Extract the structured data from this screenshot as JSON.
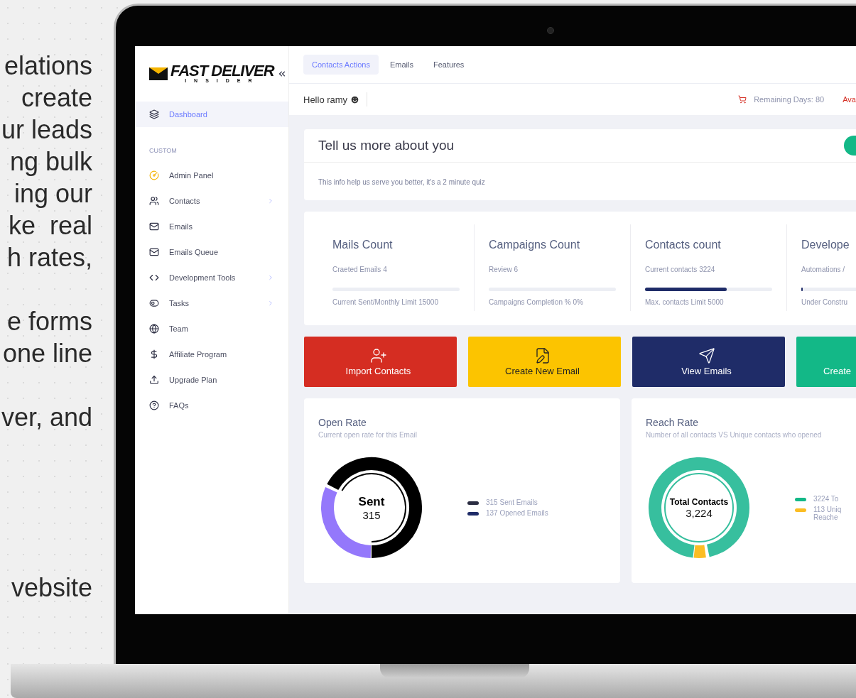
{
  "background_text": {
    "paragraphs": [
      [
        "elations",
        "create",
        "ur leads",
        "ng bulk",
        "ing our",
        "ke  real",
        "h rates,"
      ],
      [
        "e forms",
        "one line"
      ],
      [
        "ver, and"
      ],
      [
        "vebsite"
      ]
    ]
  },
  "logo": {
    "title": "FAST DELIVER",
    "subtitle": "INSIDER"
  },
  "sidebar": {
    "items": [
      {
        "label": "Dashboard",
        "selected": true,
        "expandable": false
      }
    ],
    "section": "CUSTOM",
    "section_items": [
      {
        "label": "Admin Panel",
        "selected": false,
        "expandable": false
      },
      {
        "label": "Contacts",
        "selected": false,
        "expandable": true
      },
      {
        "label": "Emails",
        "selected": false,
        "expandable": false
      },
      {
        "label": "Emails Queue",
        "selected": false,
        "expandable": false
      },
      {
        "label": "Development Tools",
        "selected": false,
        "expandable": true
      },
      {
        "label": "Tasks",
        "selected": false,
        "expandable": true
      },
      {
        "label": "Team",
        "selected": false,
        "expandable": false
      },
      {
        "label": "Affiliate Program",
        "selected": false,
        "expandable": false
      },
      {
        "label": "Upgrade Plan",
        "selected": false,
        "expandable": false
      },
      {
        "label": "FAQs",
        "selected": false,
        "expandable": false
      }
    ]
  },
  "tabs": [
    {
      "label": "Contacts Actions",
      "selected": true
    },
    {
      "label": "Emails",
      "selected": false
    },
    {
      "label": "Features",
      "selected": false
    }
  ],
  "header": {
    "greeting": "Hello ramy",
    "remaining": "Remaining Days: 80",
    "available": "Ava"
  },
  "intro_card": {
    "title": "Tell us more about you",
    "text": "This info help us serve you better, it's a 2 minute quiz"
  },
  "stats": [
    {
      "title": "Mails Count",
      "line": "Craeted Emails  4",
      "level": 0,
      "note": "Current Sent/Monthly Limit 15000"
    },
    {
      "title": "Campaigns Count",
      "line": "Review 6",
      "level": 0,
      "note": "Campaigns Completion % 0%"
    },
    {
      "title": "Contacts count",
      "line": "Current contacts 3224",
      "level": 0.64,
      "note": "Max. contacts Limit 5000"
    },
    {
      "title": "Develope",
      "line": "Automations /",
      "level": 0.01,
      "note": "Under Constru"
    }
  ],
  "actions": [
    {
      "label": "Import Contacts",
      "color": "#d52d22"
    },
    {
      "label": "Create New Email",
      "color": "#fcc400"
    },
    {
      "label": "View Emails",
      "color": "#1f2c68"
    },
    {
      "label": "Create",
      "color": "#13b887"
    }
  ],
  "charts": [
    {
      "title": "Open Rate",
      "subtitle": "Current open rate for this Email",
      "center_title": "Sent",
      "center_value": "315",
      "legend": [
        {
          "label": "315 Sent Emails",
          "color": "#2b2d42"
        },
        {
          "label": "137 Opened Emails",
          "color": "#1f2c68"
        }
      ]
    },
    {
      "title": "Reach Rate",
      "subtitle": "Number of all contacts VS Unique contacts who opened",
      "center_title": "Total Contacts",
      "center_value": "3,224",
      "legend": [
        {
          "label": "3224 To",
          "color": "#13b887"
        },
        {
          "label": "113 Uniq Reache",
          "color": "#fbbd23"
        }
      ]
    }
  ]
}
